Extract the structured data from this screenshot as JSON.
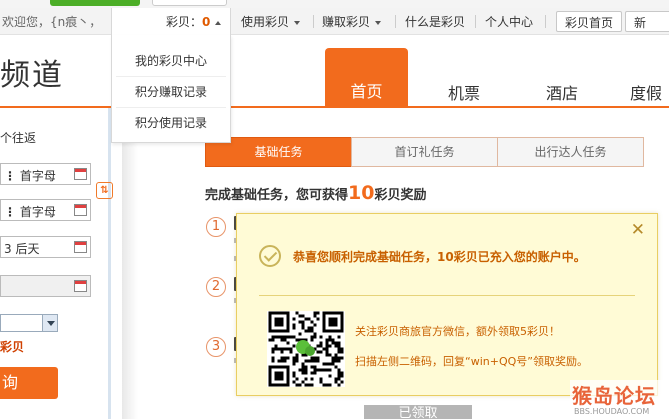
{
  "top_nav": {
    "welcome": "欢迎您，{n痕丶，",
    "caibei_label": "彩贝：",
    "caibei_count": "0",
    "use_caibei": "使用彩贝",
    "earn_caibei": "赚取彩贝",
    "what_is_caibei": "什么是彩贝",
    "personal_center": "个人中心",
    "caibei_home": "彩贝首页",
    "new_partial": "新"
  },
  "dropdown": {
    "items": [
      "我的彩贝中心",
      "积分赚取记录",
      "积分使用记录"
    ]
  },
  "header": {
    "logo_partial": "频道",
    "tabs": [
      "首页",
      "机票",
      "酒店",
      "度假"
    ]
  },
  "search_form": {
    "trip_type": "个往返",
    "from_value": "首字母",
    "to_value": "首字母",
    "date_value": "3 后天",
    "airline_label": "彩贝",
    "search_button": "询"
  },
  "task_tabs": [
    "基础任务",
    "首订礼任务",
    "出行达人任务"
  ],
  "task_heading": {
    "before": "完成基础任务，您可获得",
    "amount": "10",
    "after": "彩贝奖励"
  },
  "steps": [
    "1",
    "2",
    "3"
  ],
  "received_button": "已领取",
  "popup": {
    "close": "✕",
    "success": "恭喜您顺利完成基础任务，10彩贝已充入您的账户中。",
    "line1": "关注彩贝商旅官方微信，额外领取5彩贝！",
    "line2": "扫描左侧二维码，回复“win+QQ号”领取奖励。"
  },
  "watermark": {
    "title": "猴岛论坛",
    "url": "BBS.HOUDAO.COM"
  },
  "colors": {
    "accent": "#f26b1d",
    "popup_bg": "#fffbd6",
    "popup_text": "#c86000"
  }
}
